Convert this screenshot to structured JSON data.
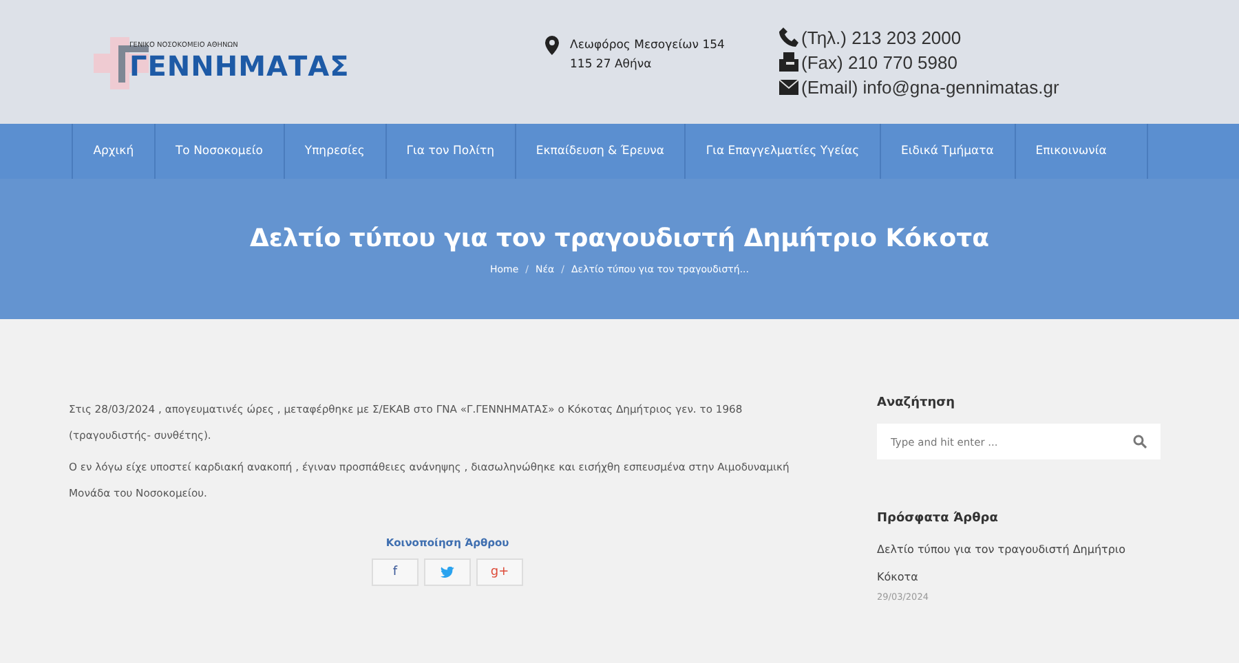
{
  "header": {
    "logo": {
      "subtitle": "ΓΕΝΙΚΟ ΝΟΣΟΚΟΜΕΙΟ ΑΘΗΝΩΝ",
      "title": "ΓΕΝΝΗΜΑΤΑΣ"
    },
    "address": [
      "Λεωφόρος Μεσογείων 154",
      "115 27 Αθήνα"
    ],
    "contacts": [
      {
        "kind": "phone",
        "text": "(Τηλ.) 213 203 2000"
      },
      {
        "kind": "fax",
        "text": "(Fax) 210 770 5980"
      },
      {
        "kind": "email",
        "text": "(Email) info@gna-gennimatas.gr"
      }
    ]
  },
  "nav": [
    {
      "label": "Αρχική",
      "selected": false
    },
    {
      "label": "Το Νοσοκομείο",
      "selected": false
    },
    {
      "label": "Υπηρεσίες",
      "selected": false
    },
    {
      "label": "Για τον Πολίτη",
      "selected": false
    },
    {
      "label": "Εκπαίδευση & Έρευνα",
      "selected": false
    },
    {
      "label": "Για Επαγγελματίες Υγείας",
      "selected": false
    },
    {
      "label": "Ειδικά Τμήματα",
      "selected": false
    },
    {
      "label": "Επικοινωνία",
      "selected": false
    }
  ],
  "page_title": "Δελτίο τύπου για τον τραγουδιστή Δημήτριο Κόκοτα",
  "breadcrumb": [
    {
      "kind": "link",
      "text": "Home"
    },
    {
      "kind": "separator",
      "text": "/"
    },
    {
      "kind": "link",
      "text": "Νέα"
    },
    {
      "kind": "separator",
      "text": "/"
    },
    {
      "kind": "current",
      "text": "Δελτίο τύπου για τον τραγουδιστή..."
    }
  ],
  "article": {
    "paragraphs": [
      "Στις 28/03/2024 , απογευματινές ώρες , μεταφέρθηκε με Σ/ΕΚΑΒ στο ΓΝΑ «Γ.ΓΕΝΝΗΜΑΤΑΣ» ο Κόκοτας Δημήτριος γεν. το 1968 (τραγουδιστής- συνθέτης).",
      "Ο εν λόγω είχε υποστεί καρδιακή ανακοπή , έγιναν προσπάθειες ανάνηψης , διασωληνώθηκε και εισήχθη εσπευσμένα στην Αιμοδυναμική Μονάδα του Νοσοκομείου."
    ],
    "share": {
      "title": "Κοινοποίηση Άρθρου",
      "buttons": [
        {
          "kind": "facebook",
          "label": "f"
        },
        {
          "kind": "twitter"
        },
        {
          "kind": "googleplus",
          "label": "g+"
        }
      ]
    }
  },
  "sidebar": {
    "search": {
      "title": "Αναζήτηση",
      "placeholder": "Type and hit enter ..."
    },
    "recent": {
      "title": "Πρόσφατα Άρθρα",
      "items": [
        {
          "title": "Δελτίο τύπου για τον τραγουδιστή Δημήτριο Κόκοτα",
          "date": "29/03/2024"
        }
      ]
    }
  }
}
